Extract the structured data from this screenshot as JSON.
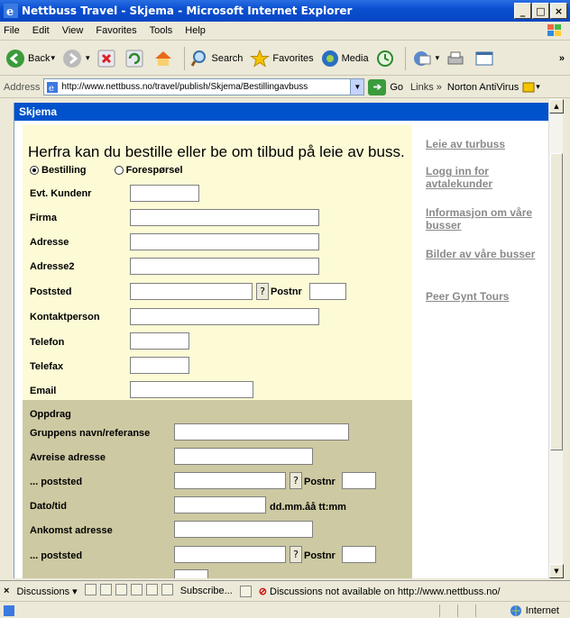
{
  "window": {
    "title": "Nettbuss Travel - Skjema - Microsoft Internet Explorer"
  },
  "menu": [
    "File",
    "Edit",
    "View",
    "Favorites",
    "Tools",
    "Help"
  ],
  "toolbar": {
    "back": "Back",
    "search": "Search",
    "favorites": "Favorites",
    "media": "Media"
  },
  "address": {
    "label": "Address",
    "url": "http://www.nettbuss.no/travel/publish/Skjema/Bestillingavbuss",
    "go": "Go",
    "links": "Links",
    "norton": "Norton AntiVirus"
  },
  "page": {
    "header": "Skjema",
    "heading": "Herfra kan du bestille eller be om tilbud på leie av buss.",
    "radio_bestilling": "Bestilling",
    "radio_foresporsel": "Forespørsel",
    "fields": {
      "kundenr": "Evt. Kundenr",
      "firma": "Firma",
      "adresse": "Adresse",
      "adresse2": "Adresse2",
      "poststed": "Poststed",
      "postnr": "Postnr",
      "kontakt": "Kontaktperson",
      "telefon": "Telefon",
      "telefax": "Telefax",
      "email": "Email"
    },
    "oppdrag": {
      "title": "Oppdrag",
      "gruppens": "Gruppens navn/referanse",
      "avreise": "Avreise adresse",
      "poststed": "... poststed",
      "postnr": "Postnr",
      "dato": "Dato/tid",
      "dato_hint": "dd.mm.åå tt:mm",
      "ankomst": "Ankomst adresse",
      "poststed2": "... poststed",
      "postnr2": "Postnr"
    },
    "question": "?",
    "sidelinks": [
      "Leie av turbuss",
      "Logg inn for avtalekunder",
      "Informasjon om våre busser",
      "Bilder av våre busser",
      "Peer Gynt Tours"
    ]
  },
  "discussions": {
    "label": "Discussions",
    "subscribe": "Subscribe...",
    "status": "Discussions not available on http://www.nettbuss.no/"
  },
  "status": {
    "zone": "Internet"
  }
}
